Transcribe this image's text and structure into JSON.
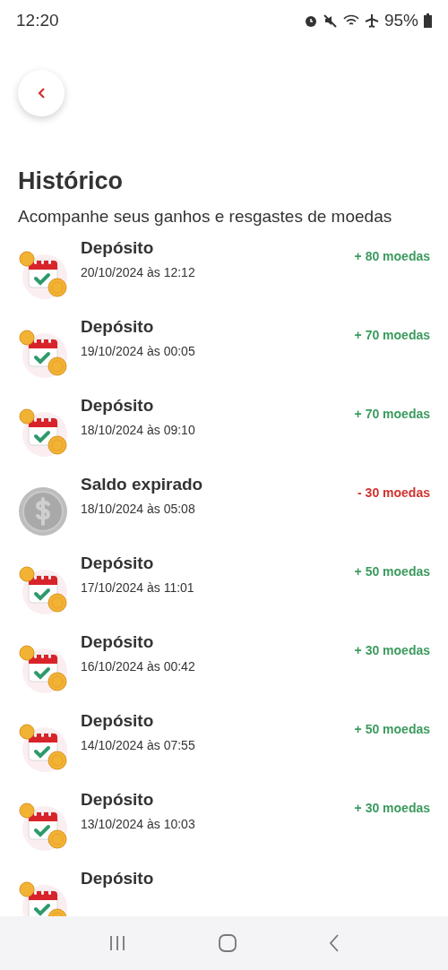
{
  "status_bar": {
    "time": "12:20",
    "battery": "95%"
  },
  "title": "Histórico",
  "subtitle": "Acompanhe seus ganhos e resgastes de moedas",
  "transactions": [
    {
      "kind": "deposit",
      "title": "Depósito",
      "date": "20/10/2024 às 12:12",
      "amount": "+ 80 moedas"
    },
    {
      "kind": "deposit",
      "title": "Depósito",
      "date": "19/10/2024 às 00:05",
      "amount": "+ 70 moedas"
    },
    {
      "kind": "deposit",
      "title": "Depósito",
      "date": "18/10/2024 às 09:10",
      "amount": "+ 70 moedas"
    },
    {
      "kind": "expired",
      "title": "Saldo expirado",
      "date": "18/10/2024 às 05:08",
      "amount": "- 30 moedas"
    },
    {
      "kind": "deposit",
      "title": "Depósito",
      "date": "17/10/2024 às 11:01",
      "amount": "+ 50 moedas"
    },
    {
      "kind": "deposit",
      "title": "Depósito",
      "date": "16/10/2024 às 00:42",
      "amount": "+ 30 moedas"
    },
    {
      "kind": "deposit",
      "title": "Depósito",
      "date": "14/10/2024 às 07:55",
      "amount": "+ 50 moedas"
    },
    {
      "kind": "deposit",
      "title": "Depósito",
      "date": "13/10/2024 às 10:03",
      "amount": "+ 30 moedas"
    },
    {
      "kind": "deposit",
      "title": "Depósito"
    }
  ]
}
